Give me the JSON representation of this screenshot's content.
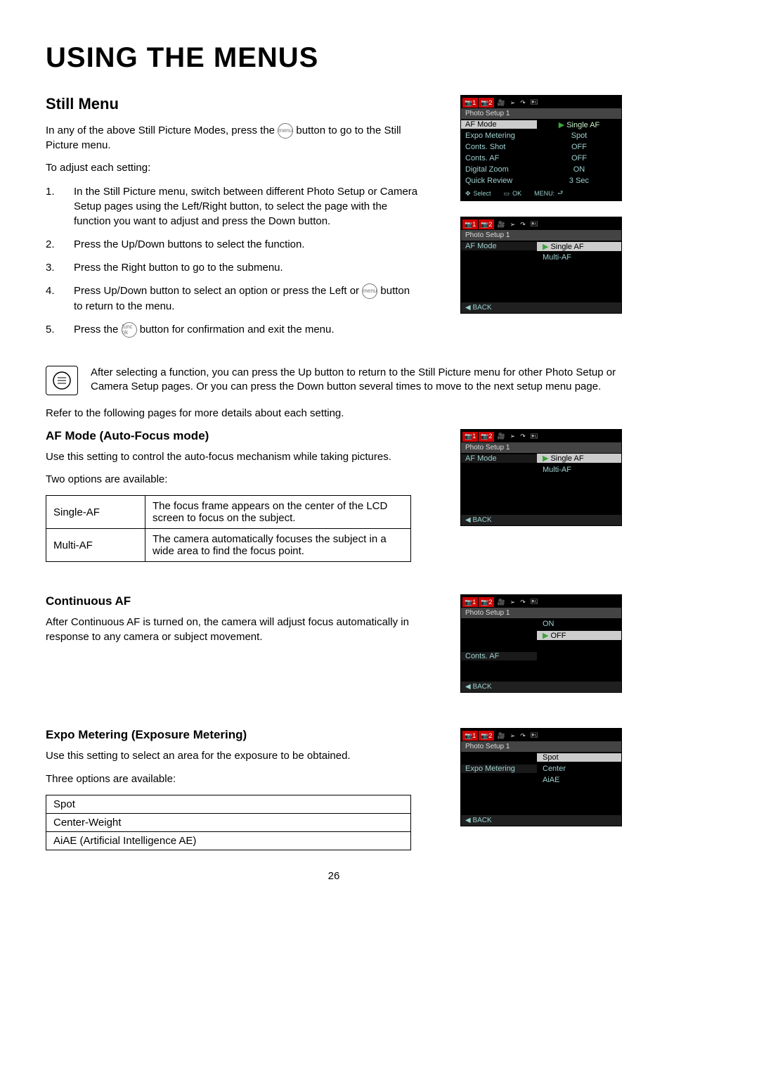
{
  "title": "USING THE MENUS",
  "section_still_menu": "Still Menu",
  "intro_1a": "In any of the above Still Picture Modes, press the ",
  "intro_1b": " button to go to the Still Picture menu.",
  "menu_btn": "menu",
  "func_btn": "func ok",
  "intro_2": "To adjust each setting:",
  "steps": [
    "In the Still Picture menu, switch between different Photo Setup or Camera Setup pages using the Left/Right button, to select the page with the function you want to adjust and press the Down button.",
    "Press the Up/Down buttons to select the function.",
    "Press the Right button to go to the submenu.",
    "Press Up/Down button to select an option or press the Left or ",
    "Press the "
  ],
  "step4_tail": " button to return to the menu.",
  "step5_tail": " button for confirmation and exit the menu.",
  "note_text": "After selecting a function, you can press the Up button to return to the Still Picture menu for other Photo Setup or Camera Setup pages. Or you can press the Down button several times to move to the next setup menu page.",
  "refer_text": "Refer to the following pages for more details about each setting.",
  "af_heading": "AF Mode (Auto-Focus mode)",
  "af_text": "Use this setting to control the auto-focus mechanism while taking pictures.",
  "two_options": "Two options are available:",
  "af_table": [
    {
      "name": "Single-AF",
      "desc": "The focus frame appears on the center of the LCD screen to focus on the subject."
    },
    {
      "name": "Multi-AF",
      "desc": "The camera automatically focuses the subject in a wide area to find the focus point."
    }
  ],
  "caf_heading": "Continuous AF",
  "caf_text": "After Continuous AF is turned on, the camera will adjust focus automatically in response to any camera or subject movement.",
  "expo_heading": "Expo Metering (Exposure Metering)",
  "expo_text": "Use this setting to select an area for the exposure to be obtained.",
  "three_options": "Three options are available:",
  "expo_table": [
    "Spot",
    "Center-Weight",
    "AiAE (Artificial Intelligence AE)"
  ],
  "page_num": "26",
  "cam": {
    "crumb": "Photo Setup 1",
    "tabs": [
      "📷1",
      "📷2",
      "🎥",
      "➢",
      "↷",
      "🖭"
    ],
    "rows_main": [
      {
        "l": "AF Mode",
        "r": "Single AF",
        "sel": true,
        "arrow": true
      },
      {
        "l": "Expo Metering",
        "r": "Spot"
      },
      {
        "l": "Conts. Shot",
        "r": "OFF"
      },
      {
        "l": "Conts. AF",
        "r": "OFF"
      },
      {
        "l": "Digital Zoom",
        "r": "ON"
      },
      {
        "l": "Quick Review",
        "r": "3 Sec"
      }
    ],
    "footer": {
      "select": "Select",
      "ok": "OK",
      "menu": "MENU:"
    },
    "af_sub": {
      "l": "AF Mode",
      "opts": [
        "Single AF",
        "Multi-AF"
      ],
      "back": "BACK"
    },
    "caf_sub": {
      "l": "Conts. AF",
      "opts": [
        "ON",
        "OFF"
      ],
      "back": "BACK"
    },
    "expo_sub": {
      "l": "Expo Metering",
      "opts": [
        "Spot",
        "Center",
        "AiAE"
      ],
      "back": "BACK"
    }
  }
}
